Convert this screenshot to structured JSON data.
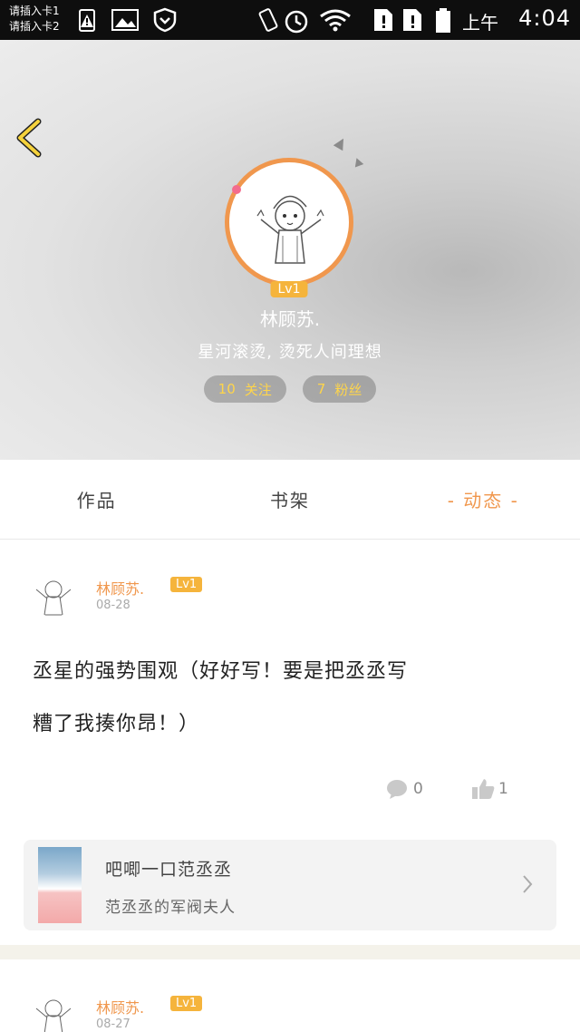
{
  "status_bar": {
    "sim1": "请插入卡1",
    "sim2": "请插入卡2",
    "ampm": "上午",
    "time": "4:04"
  },
  "profile": {
    "name": "林顾苏.",
    "level": "Lv1",
    "bio": "星河滚烫, 烫死人间理想",
    "following_count": "10",
    "following_label": "关注",
    "followers_count": "7",
    "followers_label": "粉丝"
  },
  "tabs": [
    {
      "label": "作品"
    },
    {
      "label": "书架"
    },
    {
      "label": "- 动态 -"
    }
  ],
  "posts": [
    {
      "author": "林顾苏.",
      "level": "Lv1",
      "date": "08-28",
      "text_line1": "丞星的强势围观（好好写！要是把丞丞写",
      "text_line2": "糟了我揍你昂！）",
      "comment_count": "0",
      "like_count": "1",
      "book": {
        "title": "吧唧一口范丞丞",
        "subtitle": "范丞丞的军阀夫人"
      }
    },
    {
      "author": "林顾苏.",
      "level": "Lv1",
      "date": "08-27"
    }
  ],
  "colors": {
    "accent": "#f0974d",
    "badge": "#f5b43c",
    "pill_text": "#ffd54a"
  }
}
